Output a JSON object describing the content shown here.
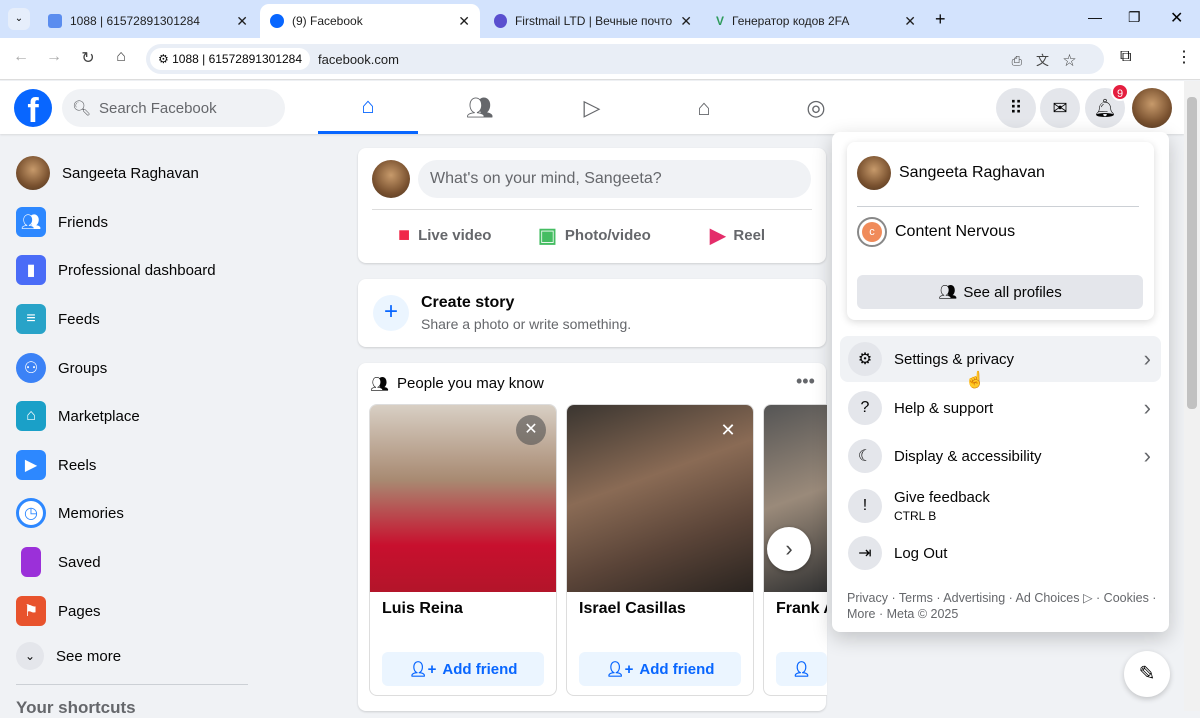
{
  "browser": {
    "tabs": [
      {
        "title": "1088 | 61572891301284",
        "active": false
      },
      {
        "title": "(9) Facebook",
        "active": true
      },
      {
        "title": "Firstmail LTD | Вечные почтовы",
        "active": false
      },
      {
        "title": "Генератор кодов 2FA",
        "active": false
      }
    ],
    "address_chip": "1088 | 61572891301284",
    "url": "facebook.com"
  },
  "header": {
    "search_placeholder": "Search Facebook",
    "notification_count": "9"
  },
  "sidebar": {
    "items": [
      {
        "label": "Sangeeta Raghavan",
        "icon": "avatar"
      },
      {
        "label": "Friends",
        "icon": "friends-icon"
      },
      {
        "label": "Professional dashboard",
        "icon": "dashboard-icon"
      },
      {
        "label": "Feeds",
        "icon": "feeds-icon"
      },
      {
        "label": "Groups",
        "icon": "groups-icon"
      },
      {
        "label": "Marketplace",
        "icon": "marketplace-icon"
      },
      {
        "label": "Reels",
        "icon": "reels-icon"
      },
      {
        "label": "Memories",
        "icon": "memories-icon"
      },
      {
        "label": "Saved",
        "icon": "saved-icon"
      },
      {
        "label": "Pages",
        "icon": "pages-icon"
      }
    ],
    "see_more": "See more",
    "shortcuts": "Your shortcuts"
  },
  "composer": {
    "placeholder": "What's on your mind, Sangeeta?",
    "live": "Live video",
    "photo": "Photo/video",
    "reel": "Reel"
  },
  "story": {
    "title": "Create story",
    "subtitle": "Share a photo or write something."
  },
  "pymk": {
    "title": "People you may know",
    "people": [
      {
        "name": "Luis Reina"
      },
      {
        "name": "Israel Casillas"
      },
      {
        "name": "Frank A"
      }
    ],
    "add_label": "Add friend"
  },
  "menu": {
    "profile": "Sangeeta Raghavan",
    "page": "Content Nervous",
    "see_all": "See all profiles",
    "items": [
      {
        "label": "Settings & privacy",
        "icon": "gear-icon"
      },
      {
        "label": "Help & support",
        "icon": "help-icon"
      },
      {
        "label": "Display & accessibility",
        "icon": "moon-icon"
      },
      {
        "label": "Give feedback",
        "sub": "CTRL B",
        "icon": "feedback-icon"
      },
      {
        "label": "Log Out",
        "icon": "logout-icon"
      }
    ],
    "footer": "Privacy · Terms · Advertising · Ad Choices ▷ · Cookies · More · Meta © 2025"
  }
}
